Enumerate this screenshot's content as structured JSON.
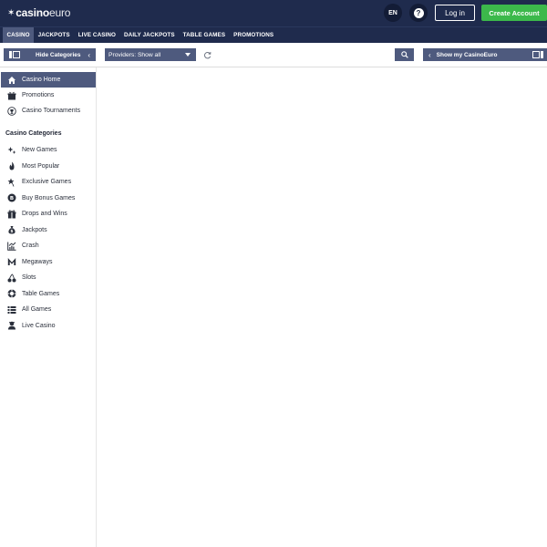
{
  "header": {
    "logo_bold": "casino",
    "logo_light": "euro",
    "lang": "EN",
    "help": "?",
    "login_label": "Log in",
    "create_label": "Create Account"
  },
  "nav": {
    "items": [
      {
        "label": "CASINO",
        "active": true
      },
      {
        "label": "JACKPOTS"
      },
      {
        "label": "LIVE CASINO"
      },
      {
        "label": "DAILY JACKPOTS"
      },
      {
        "label": "TABLE GAMES"
      },
      {
        "label": "PROMOTIONS"
      }
    ]
  },
  "toolbar": {
    "hide_categories": "Hide Categories",
    "providers": "Providers: Show all",
    "show_my": "Show my CasinoEuro"
  },
  "sidebar": {
    "top_items": [
      {
        "label": "Casino Home",
        "icon": "home-icon"
      },
      {
        "label": "Promotions",
        "icon": "gift-icon"
      },
      {
        "label": "Casino Tournaments",
        "icon": "trophy-icon"
      }
    ],
    "heading": "Casino Categories",
    "categories": [
      {
        "label": "New Games",
        "icon": "sparkle-icon"
      },
      {
        "label": "Most Popular",
        "icon": "flame-icon"
      },
      {
        "label": "Exclusive Games",
        "icon": "star-icon"
      },
      {
        "label": "Buy Bonus Games",
        "icon": "bonus-icon"
      },
      {
        "label": "Drops and Wins",
        "icon": "gift-box-icon"
      },
      {
        "label": "Jackpots",
        "icon": "money-bag-icon"
      },
      {
        "label": "Crash",
        "icon": "chart-icon"
      },
      {
        "label": "Megaways",
        "icon": "megaways-icon"
      },
      {
        "label": "Slots",
        "icon": "cherries-icon"
      },
      {
        "label": "Table Games",
        "icon": "chip-icon"
      },
      {
        "label": "All Games",
        "icon": "list-icon"
      },
      {
        "label": "Live Casino",
        "icon": "dealer-icon"
      }
    ]
  },
  "colors": {
    "header_bg": "#1f2b4d",
    "accent": "#4e5a7e",
    "create_green": "#3cb94b"
  }
}
